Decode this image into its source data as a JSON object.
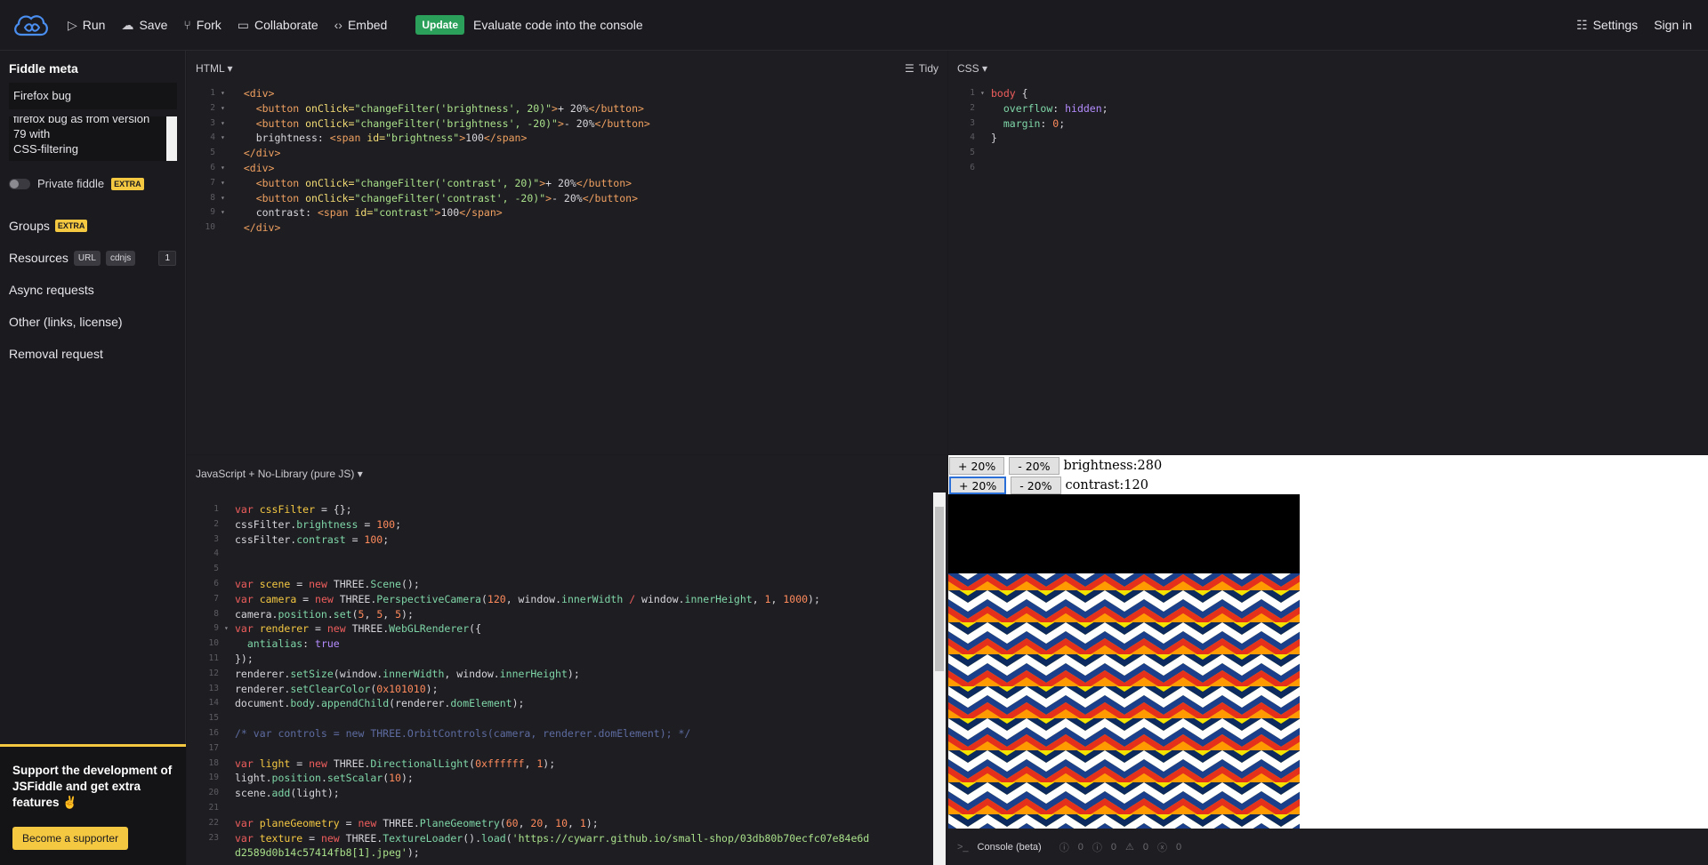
{
  "toolbar": {
    "run": "Run",
    "save": "Save",
    "fork": "Fork",
    "collaborate": "Collaborate",
    "embed": "Embed",
    "update": "Update",
    "update_hint": "Evaluate code into the console",
    "settings": "Settings",
    "signin": "Sign in"
  },
  "sidebar": {
    "title": "Fiddle meta",
    "name_value": "Firefox bug",
    "description_lines": [
      "firefox bug as from version",
      "79 with",
      "CSS-filtering"
    ],
    "private_label": "Private fiddle",
    "extra_badge": "EXTRA",
    "groups": "Groups",
    "resources": "Resources",
    "url_pill": "URL",
    "cdnjs_pill": "cdnjs",
    "resources_count": "1",
    "async": "Async requests",
    "other": "Other (links, license)",
    "removal": "Removal request",
    "support_text": "Support the development of JSFiddle and get extra features ✌",
    "support_btn": "Become a supporter"
  },
  "panels": {
    "html_label": "HTML ▾",
    "tidy": "Tidy",
    "css_label": "CSS ▾",
    "js_label": "JavaScript + No-Library (pure JS) ▾"
  },
  "result": {
    "plus": "+ 20%",
    "minus": "- 20%",
    "brightness_label": "brightness: ",
    "brightness_value": "280",
    "contrast_label": "contrast: ",
    "contrast_value": "120"
  },
  "console": {
    "label": "Console (beta)",
    "c1": "0",
    "c2": "0",
    "c3": "0",
    "c4": "0"
  },
  "colors": {
    "accent_update": "#2aa05a",
    "accent_support": "#f5c842",
    "logo": "#4a8ef0"
  }
}
